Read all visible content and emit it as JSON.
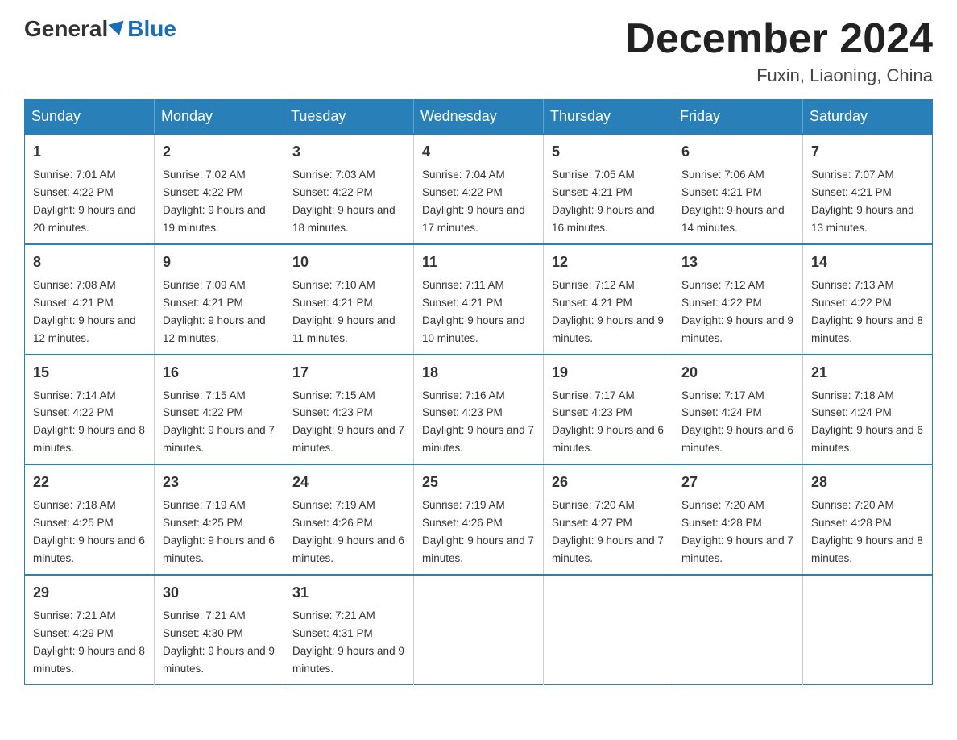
{
  "header": {
    "logo_text_general": "General",
    "logo_text_blue": "Blue",
    "month_title": "December 2024",
    "location": "Fuxin, Liaoning, China"
  },
  "days_of_week": [
    "Sunday",
    "Monday",
    "Tuesday",
    "Wednesday",
    "Thursday",
    "Friday",
    "Saturday"
  ],
  "weeks": [
    [
      {
        "day": "1",
        "sunrise": "7:01 AM",
        "sunset": "4:22 PM",
        "daylight": "9 hours and 20 minutes."
      },
      {
        "day": "2",
        "sunrise": "7:02 AM",
        "sunset": "4:22 PM",
        "daylight": "9 hours and 19 minutes."
      },
      {
        "day": "3",
        "sunrise": "7:03 AM",
        "sunset": "4:22 PM",
        "daylight": "9 hours and 18 minutes."
      },
      {
        "day": "4",
        "sunrise": "7:04 AM",
        "sunset": "4:22 PM",
        "daylight": "9 hours and 17 minutes."
      },
      {
        "day": "5",
        "sunrise": "7:05 AM",
        "sunset": "4:21 PM",
        "daylight": "9 hours and 16 minutes."
      },
      {
        "day": "6",
        "sunrise": "7:06 AM",
        "sunset": "4:21 PM",
        "daylight": "9 hours and 14 minutes."
      },
      {
        "day": "7",
        "sunrise": "7:07 AM",
        "sunset": "4:21 PM",
        "daylight": "9 hours and 13 minutes."
      }
    ],
    [
      {
        "day": "8",
        "sunrise": "7:08 AM",
        "sunset": "4:21 PM",
        "daylight": "9 hours and 12 minutes."
      },
      {
        "day": "9",
        "sunrise": "7:09 AM",
        "sunset": "4:21 PM",
        "daylight": "9 hours and 12 minutes."
      },
      {
        "day": "10",
        "sunrise": "7:10 AM",
        "sunset": "4:21 PM",
        "daylight": "9 hours and 11 minutes."
      },
      {
        "day": "11",
        "sunrise": "7:11 AM",
        "sunset": "4:21 PM",
        "daylight": "9 hours and 10 minutes."
      },
      {
        "day": "12",
        "sunrise": "7:12 AM",
        "sunset": "4:21 PM",
        "daylight": "9 hours and 9 minutes."
      },
      {
        "day": "13",
        "sunrise": "7:12 AM",
        "sunset": "4:22 PM",
        "daylight": "9 hours and 9 minutes."
      },
      {
        "day": "14",
        "sunrise": "7:13 AM",
        "sunset": "4:22 PM",
        "daylight": "9 hours and 8 minutes."
      }
    ],
    [
      {
        "day": "15",
        "sunrise": "7:14 AM",
        "sunset": "4:22 PM",
        "daylight": "9 hours and 8 minutes."
      },
      {
        "day": "16",
        "sunrise": "7:15 AM",
        "sunset": "4:22 PM",
        "daylight": "9 hours and 7 minutes."
      },
      {
        "day": "17",
        "sunrise": "7:15 AM",
        "sunset": "4:23 PM",
        "daylight": "9 hours and 7 minutes."
      },
      {
        "day": "18",
        "sunrise": "7:16 AM",
        "sunset": "4:23 PM",
        "daylight": "9 hours and 7 minutes."
      },
      {
        "day": "19",
        "sunrise": "7:17 AM",
        "sunset": "4:23 PM",
        "daylight": "9 hours and 6 minutes."
      },
      {
        "day": "20",
        "sunrise": "7:17 AM",
        "sunset": "4:24 PM",
        "daylight": "9 hours and 6 minutes."
      },
      {
        "day": "21",
        "sunrise": "7:18 AM",
        "sunset": "4:24 PM",
        "daylight": "9 hours and 6 minutes."
      }
    ],
    [
      {
        "day": "22",
        "sunrise": "7:18 AM",
        "sunset": "4:25 PM",
        "daylight": "9 hours and 6 minutes."
      },
      {
        "day": "23",
        "sunrise": "7:19 AM",
        "sunset": "4:25 PM",
        "daylight": "9 hours and 6 minutes."
      },
      {
        "day": "24",
        "sunrise": "7:19 AM",
        "sunset": "4:26 PM",
        "daylight": "9 hours and 6 minutes."
      },
      {
        "day": "25",
        "sunrise": "7:19 AM",
        "sunset": "4:26 PM",
        "daylight": "9 hours and 7 minutes."
      },
      {
        "day": "26",
        "sunrise": "7:20 AM",
        "sunset": "4:27 PM",
        "daylight": "9 hours and 7 minutes."
      },
      {
        "day": "27",
        "sunrise": "7:20 AM",
        "sunset": "4:28 PM",
        "daylight": "9 hours and 7 minutes."
      },
      {
        "day": "28",
        "sunrise": "7:20 AM",
        "sunset": "4:28 PM",
        "daylight": "9 hours and 8 minutes."
      }
    ],
    [
      {
        "day": "29",
        "sunrise": "7:21 AM",
        "sunset": "4:29 PM",
        "daylight": "9 hours and 8 minutes."
      },
      {
        "day": "30",
        "sunrise": "7:21 AM",
        "sunset": "4:30 PM",
        "daylight": "9 hours and 9 minutes."
      },
      {
        "day": "31",
        "sunrise": "7:21 AM",
        "sunset": "4:31 PM",
        "daylight": "9 hours and 9 minutes."
      },
      null,
      null,
      null,
      null
    ]
  ]
}
